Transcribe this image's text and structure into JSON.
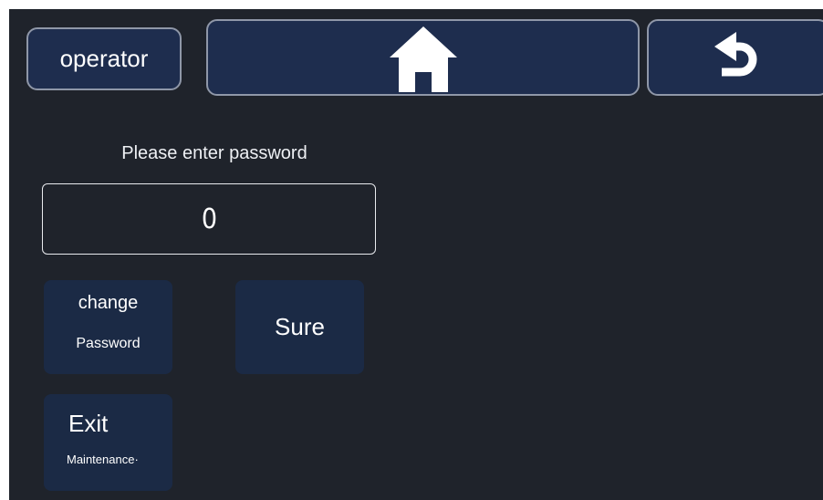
{
  "header": {
    "operator_label": "operator",
    "home_icon": "home-icon",
    "back_icon": "back-arrow-icon"
  },
  "login": {
    "prompt": "Please enter password",
    "password_value": "0"
  },
  "buttons": {
    "change_line1": "change",
    "change_line2": "Password",
    "sure": "Sure",
    "exit_line1": "Exit",
    "exit_line2": "Maintenance·"
  },
  "colors": {
    "background": "#1f232b",
    "button_fill": "#1e2d4e",
    "button_border": "#8f97a8",
    "text": "#ffffff"
  }
}
